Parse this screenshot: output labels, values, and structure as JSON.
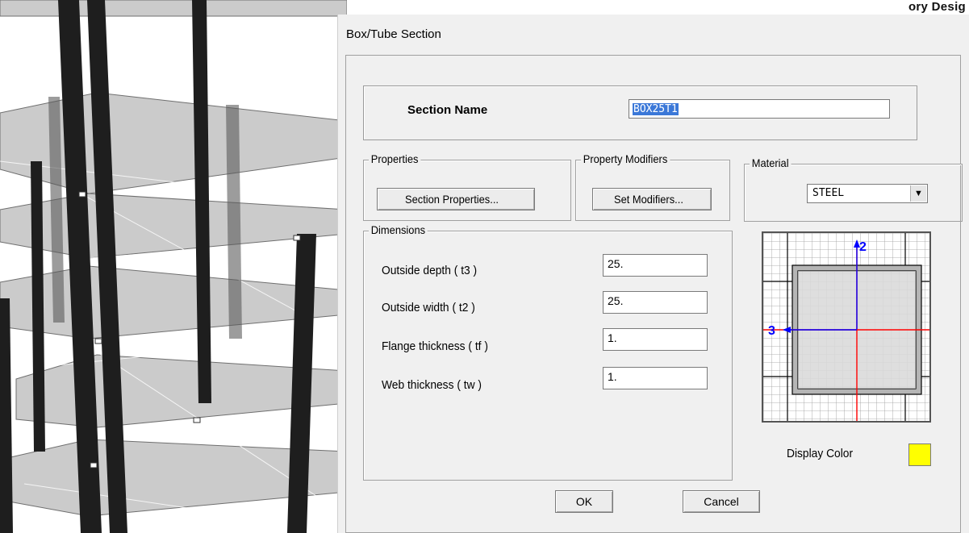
{
  "background": {
    "corner_text": "ory Desig"
  },
  "dialog": {
    "title": "Box/Tube Section",
    "section_name": {
      "label": "Section Name",
      "value": "BOX25T1"
    },
    "properties": {
      "group_title": "Properties",
      "button_label": "Section Properties..."
    },
    "property_modifiers": {
      "group_title": "Property Modifiers",
      "button_label": "Set Modifiers..."
    },
    "material": {
      "group_title": "Material",
      "selected": "STEEL"
    },
    "dimensions": {
      "group_title": "Dimensions",
      "fields": [
        {
          "label": "Outside depth  ( t3 )",
          "value": "25."
        },
        {
          "label": "Outside width  ( t2 )",
          "value": "25."
        },
        {
          "label": "Flange thickness  ( tf )",
          "value": "1."
        },
        {
          "label": "Web thickness  ( tw )",
          "value": "1."
        }
      ]
    },
    "preview": {
      "axis_vertical_label": "2",
      "axis_horizontal_label": "3"
    },
    "display_color": {
      "label": "Display Color",
      "color": "#ffff00"
    },
    "buttons": {
      "ok": "OK",
      "cancel": "Cancel"
    }
  },
  "colors": {
    "dialog_bg": "#f0f0f0",
    "selection_highlight": "#3b78d8",
    "axis_vertical": "#0000ff",
    "axis_horizontal": "#ff0000"
  },
  "icons": {
    "dropdown": "chevron-down-icon"
  }
}
